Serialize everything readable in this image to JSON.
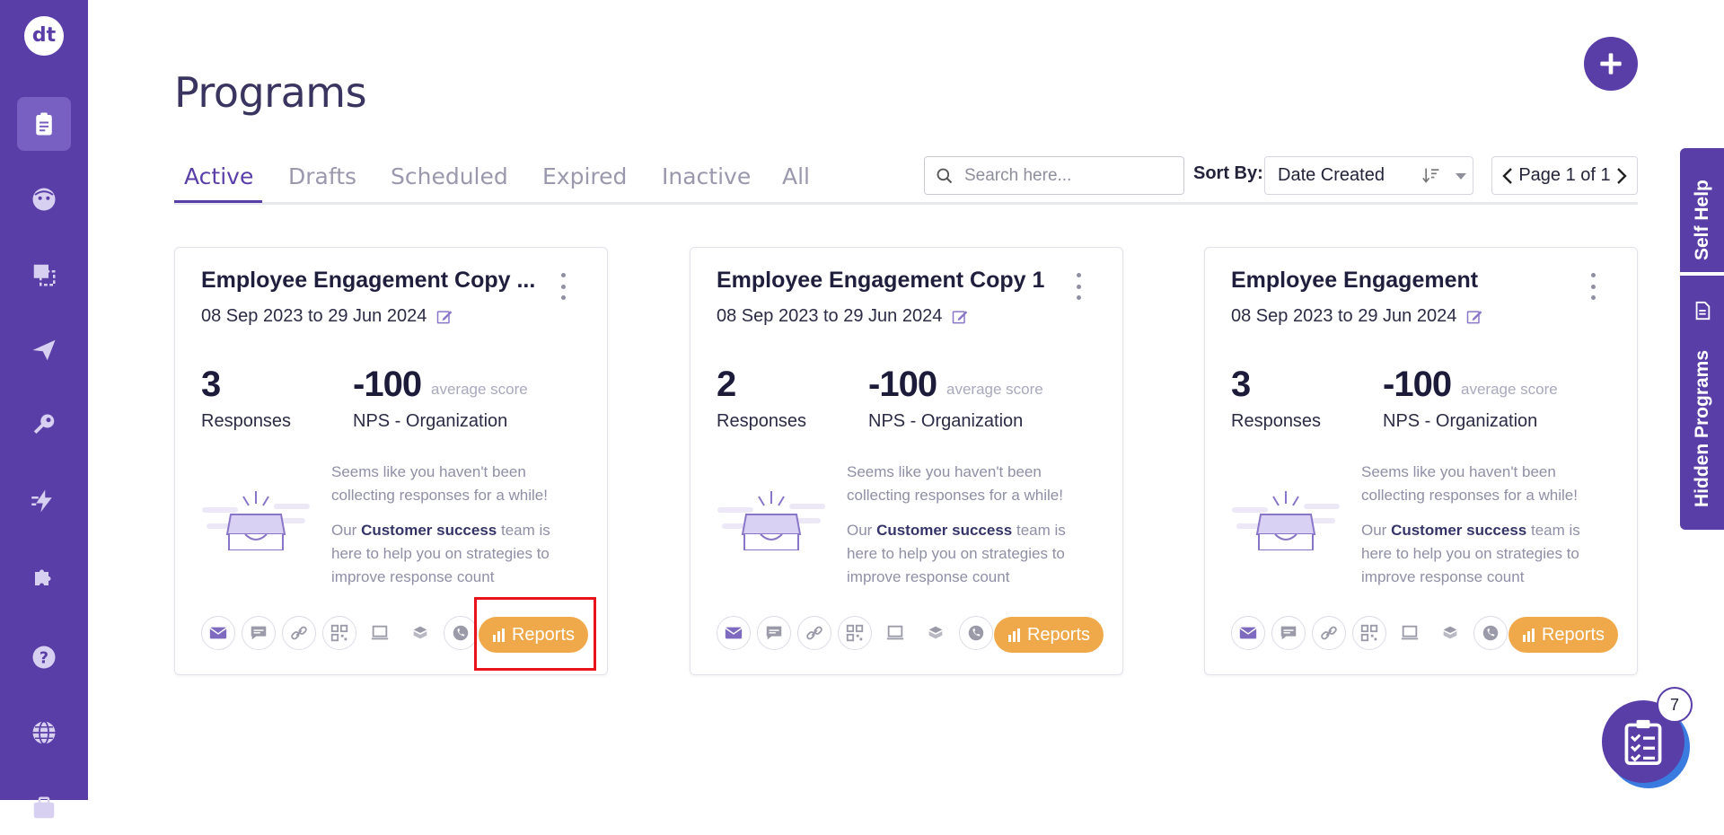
{
  "app": {
    "logo": "dt"
  },
  "sidebar": {
    "items": [
      {
        "name": "programs",
        "icon": "clipboard-icon",
        "active": true
      },
      {
        "name": "face",
        "icon": "face-icon"
      },
      {
        "name": "screens",
        "icon": "screens-icon"
      },
      {
        "name": "send",
        "icon": "send-icon"
      },
      {
        "name": "key",
        "icon": "key-icon"
      },
      {
        "name": "automation",
        "icon": "lightning-icon"
      },
      {
        "name": "integrations",
        "icon": "puzzle-icon"
      },
      {
        "name": "help",
        "icon": "help-icon"
      },
      {
        "name": "globe",
        "icon": "globe-icon"
      }
    ]
  },
  "header": {
    "title": "Programs"
  },
  "tabs": [
    {
      "label": "Active",
      "active": true
    },
    {
      "label": "Drafts"
    },
    {
      "label": "Scheduled"
    },
    {
      "label": "Expired"
    },
    {
      "label": "Inactive"
    },
    {
      "label": "All"
    }
  ],
  "toolbar": {
    "search_placeholder": "Search here...",
    "sort_label": "Sort By:",
    "sort_value": "Date Created",
    "page_text": "Page 1 of 1"
  },
  "cards": [
    {
      "title": "Employee Engagement Copy ...",
      "dates": "08 Sep 2023 to 29 Jun 2024",
      "responses": "3",
      "responses_label": "Responses",
      "score": "-100",
      "score_caption": "average score",
      "score_label": "NPS - Organization",
      "msg1": "Seems like you haven't been collecting responses for a while!",
      "msg2_pre": "Our ",
      "msg2_bold": "Customer success",
      "msg2_post": " team is here to help you on strategies to improve response count",
      "reports_label": "Reports"
    },
    {
      "title": "Employee Engagement Copy 1",
      "dates": "08 Sep 2023 to 29 Jun 2024",
      "responses": "2",
      "responses_label": "Responses",
      "score": "-100",
      "score_caption": "average score",
      "score_label": "NPS - Organization",
      "msg1": "Seems like you haven't been collecting responses for a while!",
      "msg2_pre": "Our ",
      "msg2_bold": "Customer success",
      "msg2_post": " team is here to help you on strategies to improve response count",
      "reports_label": "Reports"
    },
    {
      "title": "Employee Engagement",
      "dates": "08 Sep 2023 to 29 Jun 2024",
      "responses": "3",
      "responses_label": "Responses",
      "score": "-100",
      "score_caption": "average score",
      "score_label": "NPS - Organization",
      "msg1": "Seems like you haven't been collecting responses for a while!",
      "msg2_pre": "Our ",
      "msg2_bold": "Customer success",
      "msg2_post": " team is here to help you on strategies to improve response count",
      "reports_label": "Reports"
    }
  ],
  "side_panel": {
    "self_help": "Self Help",
    "hidden_programs": "Hidden Programs"
  },
  "chat": {
    "badge_count": "7"
  },
  "colors": {
    "primary": "#5a3ea8",
    "accent": "#f0a94a",
    "highlight": "#e8141c"
  }
}
